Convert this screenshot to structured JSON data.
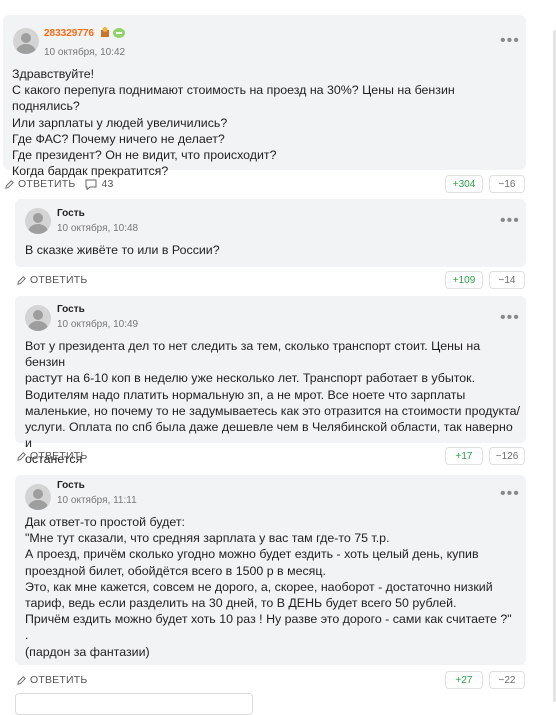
{
  "comments": [
    {
      "author": "283329776",
      "date": "10 октября, 10:42",
      "text": "Здравствуйте!\nС какого перепуга поднимают стоимость на проезд на 30%? Цены на бензин поднялись?\nИли зарплаты у людей увеличились?\nГде ФАС? Почему ничего не делает?\nГде президент? Он не видит, что происходит?\nКогда бардак прекратится?",
      "reply_label": "ОТВЕТИТЬ",
      "replies_count": "43",
      "upvotes": "+304",
      "downvotes": "−16",
      "more": "•••"
    },
    {
      "author": "Гость",
      "date": "10 октября, 10:48",
      "text": "В сказке живёте то или в России?",
      "reply_label": "ОТВЕТИТЬ",
      "upvotes": "+109",
      "downvotes": "−14",
      "more": "•••"
    },
    {
      "author": "Гость",
      "date": "10 октября, 10:49",
      "text": "Вот у президента дел то нет следить за тем, сколько транспорт стоит. Цены на бензин\nрастут на 6-10 коп в неделю уже несколько лет. Транспорт работает в убыток.\nВодителям надо платить нормальную зп, а не мрот. Все ноете что зарплаты\nмаленькие, но почему то не задумываетесь как это отразится на стоимости продукта/\nуслуги. Оплата по спб была даже дешевле чем в Челябинской области, так наверно и\nостанется",
      "reply_label": "ОТВЕТИТЬ",
      "upvotes": "+17",
      "downvotes": "−126",
      "more": "•••"
    },
    {
      "author": "Гость",
      "date": "10 октября, 11:11",
      "text": "Дак ответ-то простой будет:\n\"Мне тут сказали, что средняя зарплата у вас там где-то 75 т.р.\nА проезд, причём сколько угодно можно будет ездить - хоть целый день, купив\nпроездной билет, обойдётся всего в 1500 р в месяц.\nЭто, как мне кажется, совсем не дорого, а, скорее, наоборот - достаточно низкий\nтариф, ведь если разделить на 30 дней, то В ДЕНЬ будет всего 50 рублей.\nПричём ездить можно будет хоть 10 раз ! Ну разве это дорого - сами как считаете ?\"\n.\n(пардон за фантазии)",
      "reply_label": "ОТВЕТИТЬ",
      "upvotes": "+27",
      "downvotes": "−22",
      "more": "•••"
    }
  ]
}
